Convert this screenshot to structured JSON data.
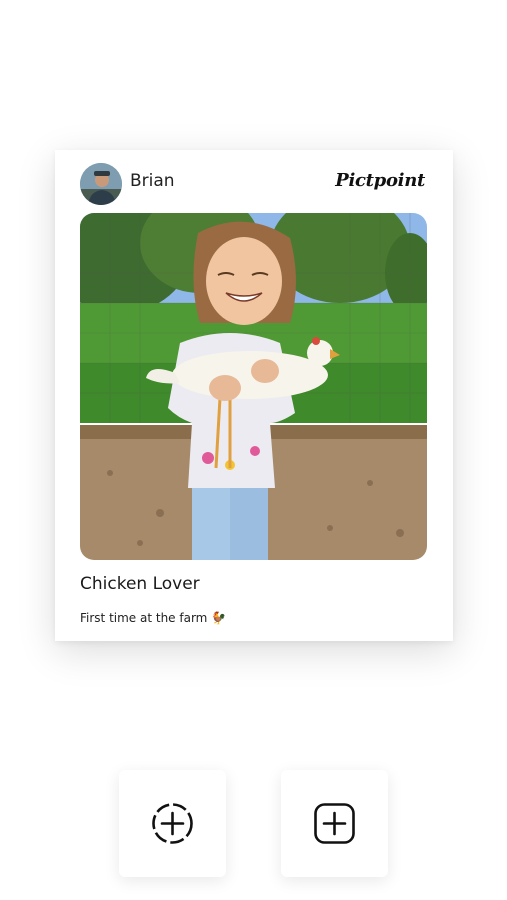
{
  "topbar": {
    "title": "",
    "back_icon": "back-arrow-icon"
  },
  "post": {
    "username": "Brian",
    "brand": "Pictpoint",
    "avatar_icon": "user-avatar",
    "photo_alt": "child-holding-chicken-photo",
    "caption_title": "Chicken Lover",
    "caption_text": "First time at the farm 🐓"
  },
  "actions": [
    {
      "label": "",
      "icon": "add-circle-dashed-icon"
    },
    {
      "label": "",
      "icon": "add-square-icon"
    }
  ]
}
